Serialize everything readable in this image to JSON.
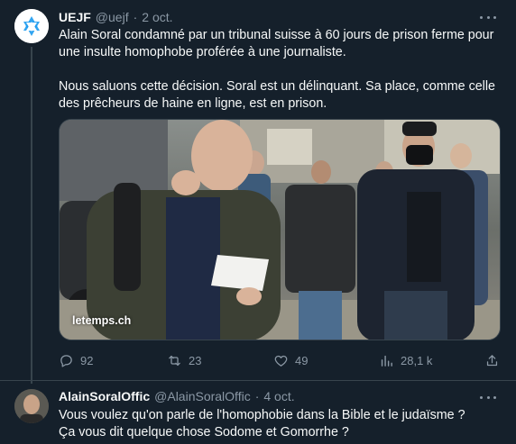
{
  "tweet1": {
    "name": "UEJF",
    "handle": "@uejf",
    "separator": "·",
    "date": "2 oct.",
    "text": [
      "Alain Soral condamné par un tribunal suisse à 60 jours de prison ferme pour une insulte homophobe proférée à une journaliste.",
      "Nous saluons cette décision. Soral est un délinquant. Sa place, comme celle des prêcheurs de haine en ligne, est en prison."
    ],
    "media_caption": "letemps.ch",
    "actions": {
      "replies": "92",
      "retweets": "23",
      "likes": "49",
      "views": "28,1 k"
    }
  },
  "tweet2": {
    "name": "AlainSoralOffic",
    "handle": "@AlainSoralOffic",
    "separator": "·",
    "date": "4 oct.",
    "text": [
      "Vous voulez qu'on parle de l'homophobie dans la Bible et le judaïsme ?",
      "Ça vous dit quelque chose Sodome et Gomorrhe ?"
    ]
  },
  "colors": {
    "background": "#15202b",
    "text": "#f7f9f9",
    "muted": "#8b98a5",
    "border": "#38444d"
  }
}
